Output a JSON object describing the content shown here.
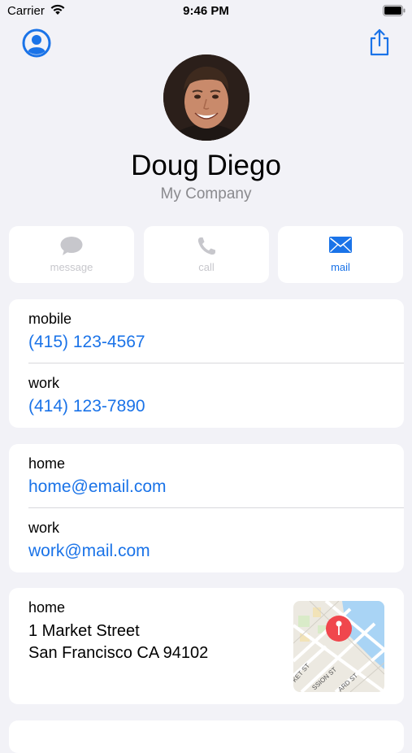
{
  "status_bar": {
    "carrier": "Carrier",
    "time": "9:46 PM"
  },
  "contact": {
    "name": "Doug Diego",
    "company": "My Company"
  },
  "actions": [
    {
      "label": "message",
      "icon": "message-icon",
      "enabled": false
    },
    {
      "label": "call",
      "icon": "phone-icon",
      "enabled": false
    },
    {
      "label": "mail",
      "icon": "mail-icon",
      "enabled": true
    }
  ],
  "phones": [
    {
      "label": "mobile",
      "value": "(415) 123-4567"
    },
    {
      "label": "work",
      "value": "(414) 123-7890"
    }
  ],
  "emails": [
    {
      "label": "home",
      "value": "home@email.com"
    },
    {
      "label": "work",
      "value": "work@mail.com"
    }
  ],
  "address": {
    "label": "home",
    "line1": "1 Market Street",
    "line2": "San Francisco CA 94102",
    "map_street_labels": [
      "KET ST",
      "SSION ST",
      "ARD ST"
    ]
  },
  "colors": {
    "accent": "#1a73e8",
    "background": "#f2f2f7",
    "disabled": "#c7c7cc",
    "pin": "#f0474d"
  }
}
